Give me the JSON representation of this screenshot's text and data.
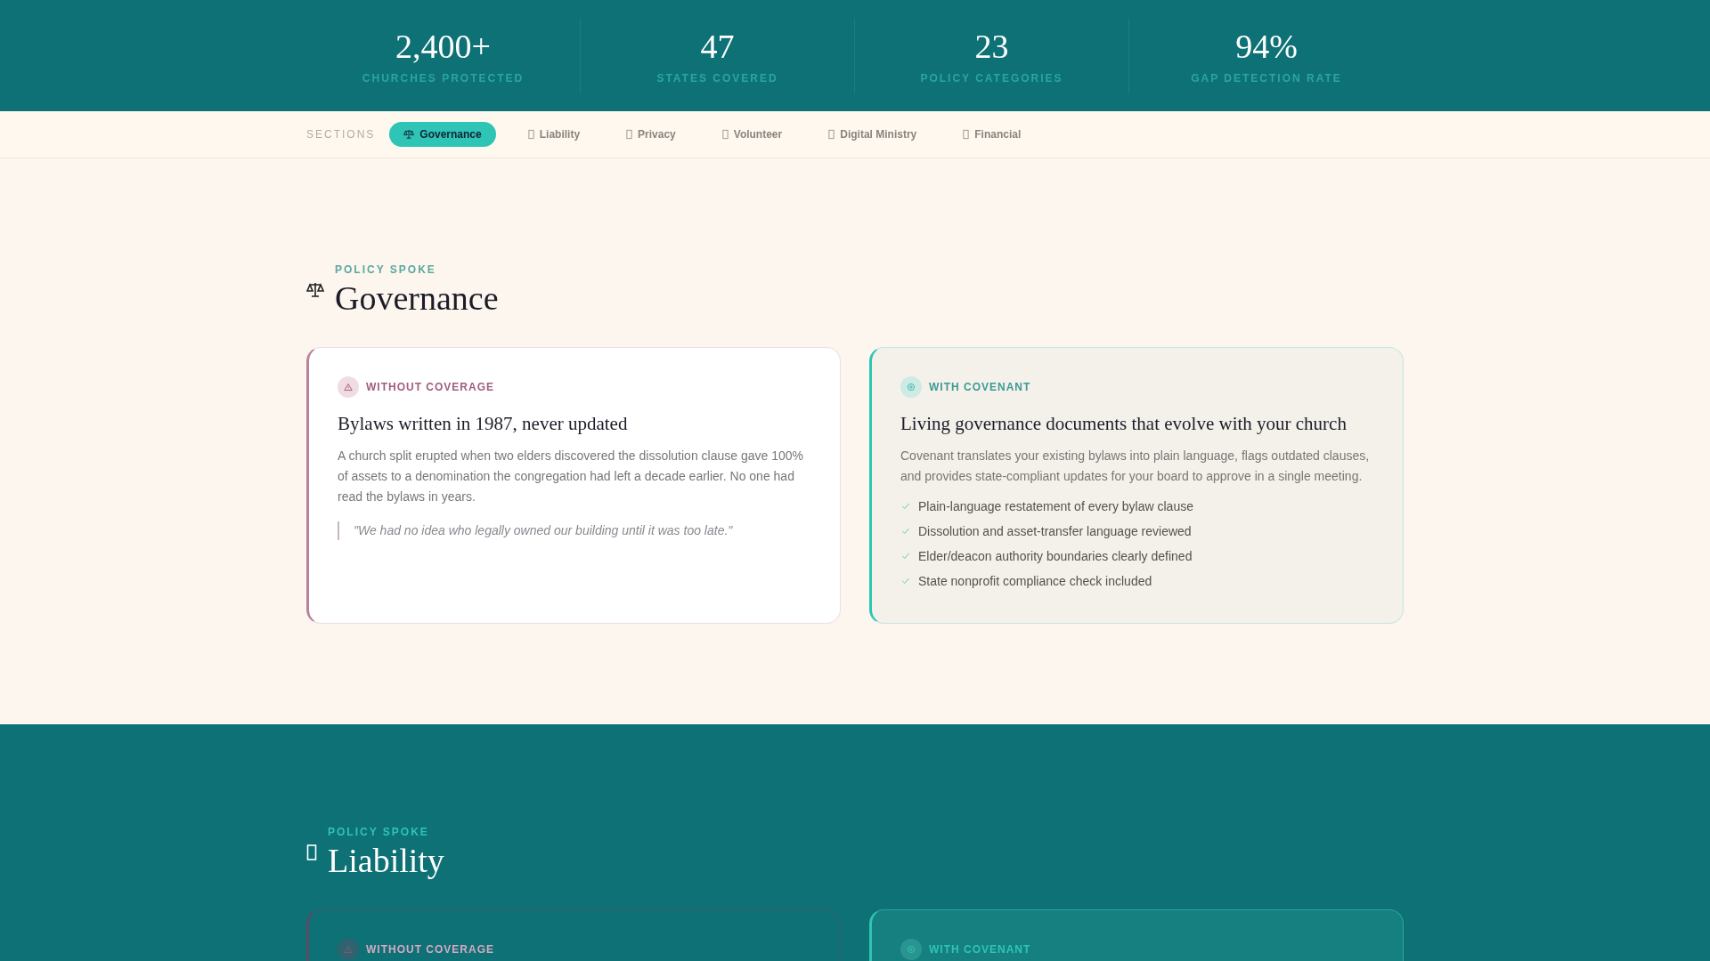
{
  "stats": [
    {
      "value": "2,400+",
      "label": "CHURCHES PROTECTED"
    },
    {
      "value": "47",
      "label": "STATES COVERED"
    },
    {
      "value": "23",
      "label": "POLICY CATEGORIES"
    },
    {
      "value": "94%",
      "label": "GAP DETECTION RATE"
    }
  ],
  "nav": {
    "label": "SECTIONS",
    "items": [
      {
        "label": "Governance",
        "selected": true
      },
      {
        "label": "Liability",
        "selected": false
      },
      {
        "label": "Privacy",
        "selected": false
      },
      {
        "label": "Volunteer",
        "selected": false
      },
      {
        "label": "Digital Ministry",
        "selected": false
      },
      {
        "label": "Financial",
        "selected": false
      }
    ]
  },
  "sections": [
    {
      "eyebrow": "POLICY SPOKE",
      "title": "Governance",
      "without": {
        "label": "WITHOUT COVERAGE",
        "title": "Bylaws written in 1987, never updated",
        "body": "A church split erupted when two elders discovered the dissolution clause gave 100% of assets to a denomination the congregation had left a decade earlier. No one had read the bylaws in years.",
        "quote": "\"We had no idea who legally owned our building until it was too late.\""
      },
      "with": {
        "label": "WITH COVENANT",
        "title": "Living governance documents that evolve with your church",
        "body": "Covenant translates your existing bylaws into plain language, flags outdated clauses, and provides state-compliant updates for your board to approve in a single meeting.",
        "points": [
          "Plain-language restatement of every bylaw clause",
          "Dissolution and asset-transfer language reviewed",
          "Elder/deacon authority boundaries clearly defined",
          "State nonprofit compliance check included"
        ]
      }
    },
    {
      "eyebrow": "POLICY SPOKE",
      "title": "Liability",
      "without": {
        "label": "WITHOUT COVERAGE"
      },
      "with": {
        "label": "WITH COVENANT"
      }
    }
  ]
}
